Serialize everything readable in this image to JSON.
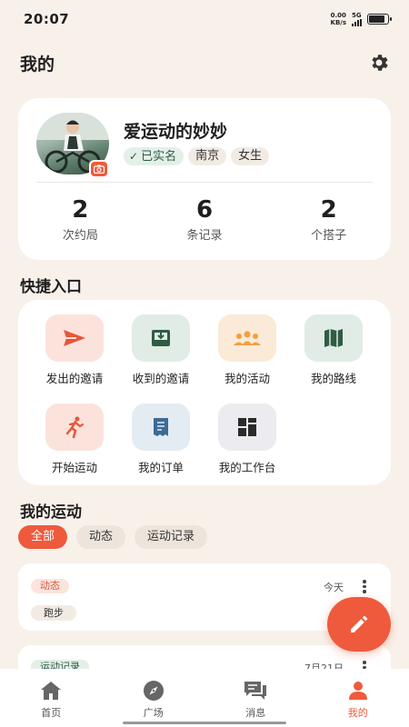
{
  "status_bar": {
    "time": "20:07",
    "net_speed_value": "0.00",
    "net_speed_unit": "KB/s",
    "network": "5G",
    "battery_level": 0.85
  },
  "header": {
    "title": "我的",
    "settings_icon": "gear-icon"
  },
  "profile": {
    "name": "爱运动的妙妙",
    "verified_label": "已实名",
    "city": "南京",
    "gender": "女生",
    "stats": [
      {
        "value": "2",
        "label": "次约局"
      },
      {
        "value": "6",
        "label": "条记录"
      },
      {
        "value": "2",
        "label": "个搭子"
      }
    ]
  },
  "quick_access": {
    "title": "快捷入口",
    "items": [
      {
        "label": "发出的邀请",
        "icon": "send-icon",
        "bg": "#fbe3dc",
        "fg": "#e9553a"
      },
      {
        "label": "收到的邀请",
        "icon": "inbox-icon",
        "bg": "#e0ece5",
        "fg": "#2f5c45"
      },
      {
        "label": "我的活动",
        "icon": "group-icon",
        "bg": "#fbead7",
        "fg": "#f0a040"
      },
      {
        "label": "我的路线",
        "icon": "map-icon",
        "bg": "#e0ece5",
        "fg": "#2f5c45"
      },
      {
        "label": "开始运动",
        "icon": "running-icon",
        "bg": "#fbe3dc",
        "fg": "#e9553a"
      },
      {
        "label": "我的订单",
        "icon": "receipt-icon",
        "bg": "#e3ecf3",
        "fg": "#3c6b96"
      },
      {
        "label": "我的工作台",
        "icon": "dashboard-icon",
        "bg": "#ecebef",
        "fg": "#2b2b2b"
      }
    ]
  },
  "my_sports": {
    "title": "我的运动",
    "filters": [
      {
        "label": "全部",
        "active": true
      },
      {
        "label": "动态",
        "active": false
      },
      {
        "label": "运动记录",
        "active": false
      }
    ],
    "posts": [
      {
        "type": "动态",
        "date": "今天",
        "sport": "跑步"
      },
      {
        "type": "运动记录",
        "date": "7月21日"
      }
    ]
  },
  "tab_bar": {
    "tabs": [
      {
        "label": "首页",
        "icon": "home-icon",
        "active": false
      },
      {
        "label": "广场",
        "icon": "compass-icon",
        "active": false
      },
      {
        "label": "消息",
        "icon": "message-icon",
        "active": false
      },
      {
        "label": "我的",
        "icon": "person-icon",
        "active": true
      }
    ]
  },
  "colors": {
    "accent": "#ef5a3c",
    "background": "#f8f1ea",
    "green": "#2e5d45"
  }
}
